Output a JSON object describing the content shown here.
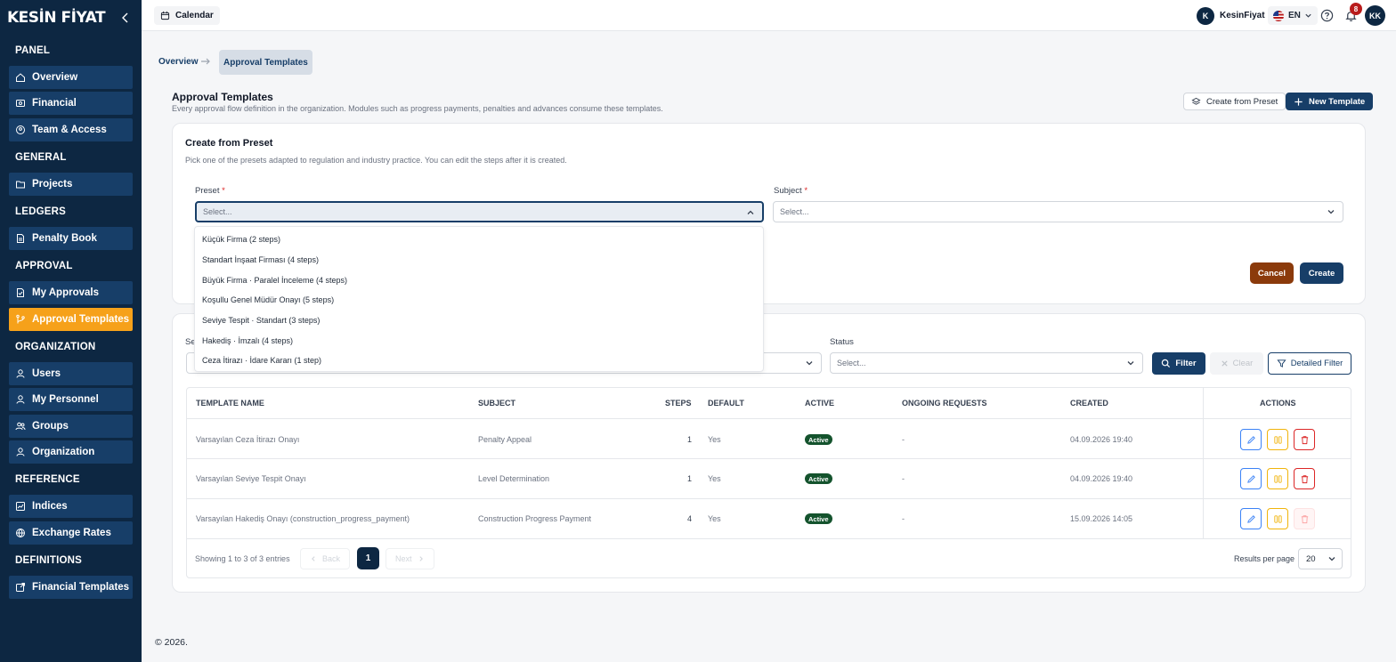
{
  "sidebar": {
    "brand": "KESİN FİYAT",
    "sections": {
      "panel": "PANEL",
      "general": "GENERAL",
      "ledgers": "LEDGERS",
      "approval": "APPROVAL",
      "organization": "ORGANIZATION",
      "reference": "REFERENCE",
      "definitions": "DEFINITIONS"
    },
    "items": {
      "overview": "Overview",
      "financial": "Financial",
      "team_access": "Team & Access",
      "projects": "Projects",
      "penalty_book": "Penalty Book",
      "my_approvals": "My Approvals",
      "approval_templates": "Approval Templates",
      "users": "Users",
      "my_personnel": "My Personnel",
      "groups": "Groups",
      "organization": "Organization",
      "indices": "Indices",
      "exchange_rates": "Exchange Rates",
      "financial_templates": "Financial Templates"
    },
    "active_color": "#f6a11a"
  },
  "topbar": {
    "calendar": "Calendar",
    "user_initial": "K",
    "user_name": "KesinFiyat",
    "language": "EN",
    "notification_count": "8",
    "avatar_initials": "KK"
  },
  "breadcrumb": {
    "first": "Overview",
    "current": "Approval Templates"
  },
  "page": {
    "title": "Approval Templates",
    "description": "Every approval flow definition in the organization. Modules such as progress payments, penalties and advances consume these templates.",
    "create_from_preset_btn": "Create from Preset",
    "new_template_btn": "New Template"
  },
  "preset_card": {
    "title": "Create from Preset",
    "description": "Pick one of the presets adapted to regulation and industry practice. You can edit the steps after it is created.",
    "preset_label": "Preset",
    "subject_label": "Subject",
    "required_mark": "*",
    "preset_placeholder": "Select...",
    "subject_placeholder": "Select...",
    "cancel": "Cancel",
    "create": "Create",
    "options": [
      "Küçük Firma (2 steps)",
      "Standart İnşaat Firması (4 steps)",
      "Büyük Firma · Paralel İnceleme (4 steps)",
      "Koşullu Genel Müdür Onayı (5 steps)",
      "Seviye Tespit · Standart (3 steps)",
      "Hakediş · İmzalı (4 steps)",
      "Ceza İtirazı · İdare Kararı (1 step)"
    ]
  },
  "filters": {
    "search_label_partial": "Se",
    "status_label": "Status",
    "status_placeholder": "Select...",
    "filter_btn": "Filter",
    "clear_btn": "Clear",
    "detailed_filter_btn": "Detailed Filter"
  },
  "table": {
    "headers": [
      "TEMPLATE NAME",
      "SUBJECT",
      "STEPS",
      "DEFAULT",
      "ACTIVE",
      "ONGOING REQUESTS",
      "CREATED",
      "ACTIONS"
    ],
    "rows": [
      {
        "name": "Varsayılan Ceza İtirazı Onayı",
        "subject": "Penalty Appeal",
        "steps": "1",
        "default": "Yes",
        "active": "Active",
        "ongoing": "-",
        "created": "04.09.2026 19:40"
      },
      {
        "name": "Varsayılan Seviye Tespit Onayı",
        "subject": "Level Determination",
        "steps": "1",
        "default": "Yes",
        "active": "Active",
        "ongoing": "-",
        "created": "04.09.2026 19:40"
      },
      {
        "name": "Varsayılan Hakediş Onayı (construction_progress_payment)",
        "subject": "Construction Progress Payment",
        "steps": "4",
        "default": "Yes",
        "active": "Active",
        "ongoing": "-",
        "created": "15.09.2026 14:05"
      }
    ]
  },
  "pagination": {
    "showing": "Showing 1 to 3 of 3 entries",
    "back": "Back",
    "current_page": "1",
    "next": "Next",
    "results_per_page_label": "Results per page",
    "results_per_page": "20"
  },
  "footer": "© 2026."
}
